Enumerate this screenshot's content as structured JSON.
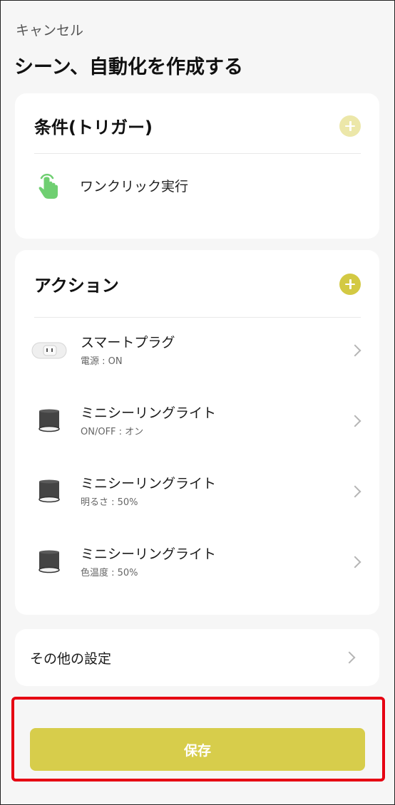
{
  "header": {
    "cancel_label": "キャンセル",
    "title": "シーン、自動化を作成する"
  },
  "trigger_section": {
    "title": "条件(トリガー)",
    "add_color": "#ece7a9",
    "items": [
      {
        "label": "ワンクリック実行",
        "icon": "tap-hand-icon"
      }
    ]
  },
  "action_section": {
    "title": "アクション",
    "add_color": "#d3c943",
    "items": [
      {
        "name": "スマートプラグ",
        "detail": "電源 : ON",
        "icon": "smart-plug-icon"
      },
      {
        "name": "ミニシーリングライト",
        "detail": "ON/OFF : オン",
        "icon": "ceiling-light-icon"
      },
      {
        "name": "ミニシーリングライト",
        "detail": "明るさ : 50%",
        "icon": "ceiling-light-icon"
      },
      {
        "name": "ミニシーリングライト",
        "detail": "色温度 : 50%",
        "icon": "ceiling-light-icon"
      }
    ]
  },
  "other_settings": {
    "label": "その他の設定"
  },
  "save": {
    "label": "保存",
    "color": "#d7cd4b"
  },
  "colors": {
    "highlight_border": "#e60012",
    "tap_icon": "#6fcf71"
  }
}
